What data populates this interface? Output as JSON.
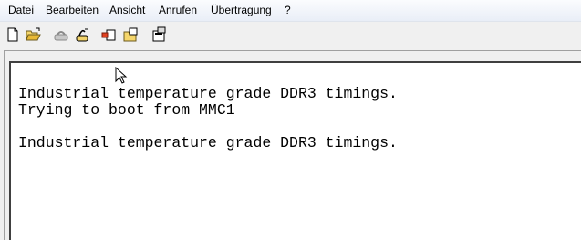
{
  "menu": {
    "items": [
      {
        "label": "Datei"
      },
      {
        "label": "Bearbeiten"
      },
      {
        "label": "Ansicht"
      },
      {
        "label": "Anrufen"
      },
      {
        "label": "Übertragung"
      },
      {
        "label": "?"
      }
    ]
  },
  "toolbar": {
    "buttons": [
      {
        "icon": "new-file-icon"
      },
      {
        "icon": "open-folder-icon"
      },
      {
        "icon": "connect-icon"
      },
      {
        "icon": "disconnect-icon"
      },
      {
        "icon": "send-icon"
      },
      {
        "icon": "receive-icon"
      },
      {
        "icon": "properties-icon"
      }
    ]
  },
  "terminal": {
    "lines": [
      "Industrial temperature grade DDR3 timings.",
      "Trying to boot from MMC1",
      "",
      "Industrial temperature grade DDR3 timings."
    ]
  }
}
